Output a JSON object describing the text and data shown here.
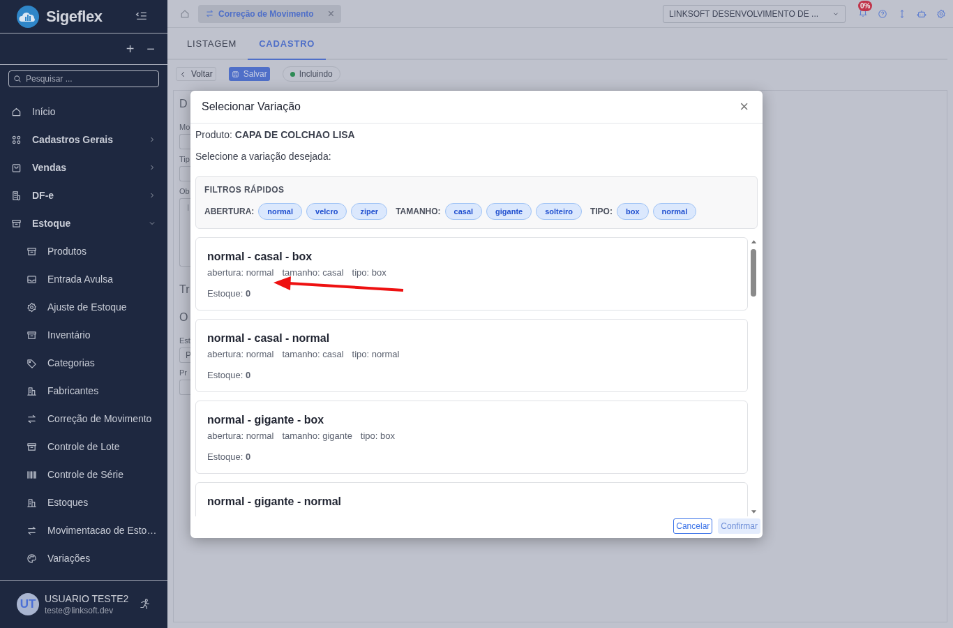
{
  "sidebar": {
    "brand": "Sigeflex",
    "search": {
      "placeholder": "Pesquisar ..."
    },
    "expand_all": "+",
    "collapse_all": "−",
    "items": [
      {
        "label": "Início",
        "kind": "link"
      },
      {
        "label": "Cadastros Gerais",
        "kind": "group",
        "expanded": false
      },
      {
        "label": "Vendas",
        "kind": "group",
        "expanded": false
      },
      {
        "label": "DF-e",
        "kind": "group",
        "expanded": false
      },
      {
        "label": "Estoque",
        "kind": "group",
        "expanded": true,
        "children": [
          {
            "label": "Produtos"
          },
          {
            "label": "Entrada Avulsa"
          },
          {
            "label": "Ajuste de Estoque"
          },
          {
            "label": "Inventário"
          },
          {
            "label": "Categorias"
          },
          {
            "label": "Fabricantes"
          },
          {
            "label": "Correção de Movimento"
          },
          {
            "label": "Controle de Lote"
          },
          {
            "label": "Controle de Série"
          },
          {
            "label": "Estoques"
          },
          {
            "label": "Movimentacao de Esto…"
          },
          {
            "label": "Variações"
          }
        ]
      }
    ],
    "user": {
      "initials": "UT",
      "name": "USUARIO TESTE2",
      "email": "teste@linksoft.dev"
    }
  },
  "topbar": {
    "open_tab": "Correção de Movimento",
    "close": "×",
    "company": "LINKSOFT DESENVOLVIMENTO DE ...",
    "badge": "0%"
  },
  "tabs": [
    {
      "label": "LISTAGEM",
      "selected": false
    },
    {
      "label": "CADASTRO",
      "selected": true
    }
  ],
  "toolbar": {
    "back": "Voltar",
    "save": "Salvar",
    "status": "Incluindo"
  },
  "form_fragments": [
    {
      "text": "D",
      "kind": "heading"
    },
    {
      "text": "Mo",
      "kind": "label"
    },
    {
      "kind": "field"
    },
    {
      "text": "Tip",
      "kind": "label"
    },
    {
      "kind": "field"
    },
    {
      "text": "Ob",
      "kind": "label"
    },
    {
      "text": "I",
      "kind": "area"
    },
    {
      "text": "Tr",
      "kind": "heading"
    },
    {
      "text": "O",
      "kind": "heading"
    },
    {
      "text": "Est",
      "kind": "label"
    },
    {
      "text": "P",
      "kind": "field"
    },
    {
      "text": "Pr",
      "kind": "label"
    },
    {
      "kind": "field"
    }
  ],
  "modal": {
    "title": "Selecionar Variação",
    "close": "×",
    "product": "Produto: **CAPA DE COLCHAO LISA**",
    "prompt": "Selecione a variação desejada:",
    "filters": {
      "title": "FILTROS RÁPIDOS",
      "groups": [
        {
          "label": "ABERTURA:",
          "chips": [
            "normal",
            "velcro",
            "ziper"
          ]
        },
        {
          "label": "TAMANHO:",
          "chips": [
            "casal",
            "gigante",
            "solteiro"
          ]
        },
        {
          "label": "TIPO:",
          "chips": [
            "box",
            "normal"
          ]
        }
      ]
    },
    "variations": [
      {
        "title": "normal - casal - box",
        "attributes": [
          "abertura: normal",
          "tamanho: casal",
          "tipo: box"
        ],
        "stock": "Estoque: **0**"
      },
      {
        "title": "normal - casal - normal",
        "attributes": [
          "abertura: normal",
          "tamanho: casal",
          "tipo: normal"
        ],
        "stock": "Estoque: **0**"
      },
      {
        "title": "normal - gigante - box",
        "attributes": [
          "abertura: normal",
          "tamanho: gigante",
          "tipo: box"
        ],
        "stock": "Estoque: **0**"
      },
      {
        "title": "normal - gigante - normal"
      }
    ],
    "buttons": [
      {
        "label": "Cancelar",
        "disabled": false
      },
      {
        "label": "Confirmar",
        "disabled": true
      }
    ]
  }
}
